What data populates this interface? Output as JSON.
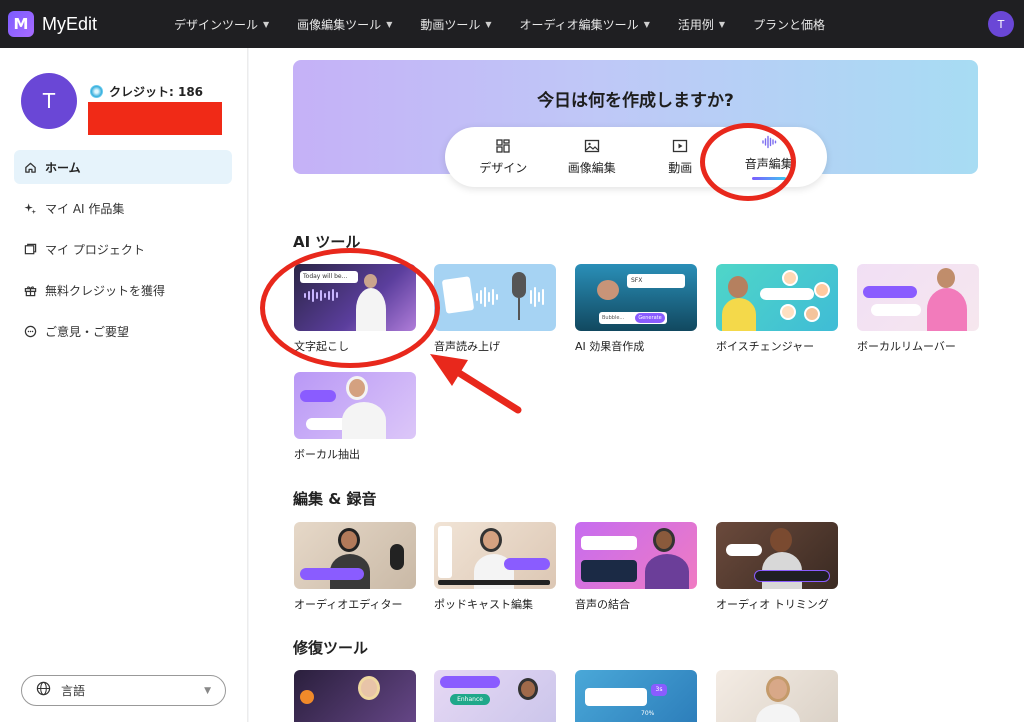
{
  "app": {
    "name": "MyEdit",
    "logo_letter": "M"
  },
  "topnav": {
    "items": [
      {
        "label": "デザインツール",
        "has_dropdown": true
      },
      {
        "label": "画像編集ツール",
        "has_dropdown": true
      },
      {
        "label": "動画ツール",
        "has_dropdown": true
      },
      {
        "label": "オーディオ編集ツール",
        "has_dropdown": true
      },
      {
        "label": "活用例",
        "has_dropdown": true
      },
      {
        "label": "プランと価格",
        "has_dropdown": false
      }
    ],
    "avatar_initial": "T"
  },
  "sidebar": {
    "avatar_initial": "T",
    "credit_label": "クレジット: 186",
    "items": [
      {
        "label": "ホーム",
        "icon": "home-icon",
        "active": true
      },
      {
        "label": "マイ AI 作品集",
        "icon": "sparkle-icon",
        "active": false
      },
      {
        "label": "マイ プロジェクト",
        "icon": "folder-icon",
        "active": false
      },
      {
        "label": "無料クレジットを獲得",
        "icon": "gift-icon",
        "active": false
      },
      {
        "label": "ご意見・ご要望",
        "icon": "chat-icon",
        "active": false
      }
    ],
    "language_label": "言語"
  },
  "hero": {
    "title": "今日は何を作成しますか?",
    "tabs": [
      {
        "label": "デザイン",
        "icon": "layout-icon",
        "active": false
      },
      {
        "label": "画像編集",
        "icon": "image-icon",
        "active": false
      },
      {
        "label": "動画",
        "icon": "play-icon",
        "active": false
      },
      {
        "label": "音声編集",
        "icon": "waveform-icon",
        "active": true
      }
    ]
  },
  "sections": {
    "ai_tools": {
      "title": "AI ツール",
      "cards": [
        {
          "label": "文字起こし",
          "thumb_text": "Today will be..."
        },
        {
          "label": "音声読み上げ"
        },
        {
          "label": "AI 効果音作成",
          "thumb_text": "SFX",
          "thumb_button": "Generate",
          "thumb_field": "Bubble..."
        },
        {
          "label": "ボイスチェンジャー"
        },
        {
          "label": "ボーカルリムーバー"
        },
        {
          "label": "ボーカル抽出"
        }
      ]
    },
    "edit_record": {
      "title": "編集 & 録音",
      "cards": [
        {
          "label": "オーディオエディター"
        },
        {
          "label": "ポッドキャスト編集"
        },
        {
          "label": "音声の結合"
        },
        {
          "label": "オーディオ トリミング"
        }
      ]
    },
    "repair": {
      "title": "修復ツール",
      "cards": [
        {
          "label": ""
        },
        {
          "label": "",
          "thumb_button": "Enhance"
        },
        {
          "label": "",
          "thumb_text": "3s",
          "thumb_percent": "70%"
        },
        {
          "label": ""
        }
      ]
    }
  },
  "colors": {
    "annotation_red": "#e8281c",
    "accent_purple": "#6a47d6",
    "topbar": "#1f1f22"
  }
}
